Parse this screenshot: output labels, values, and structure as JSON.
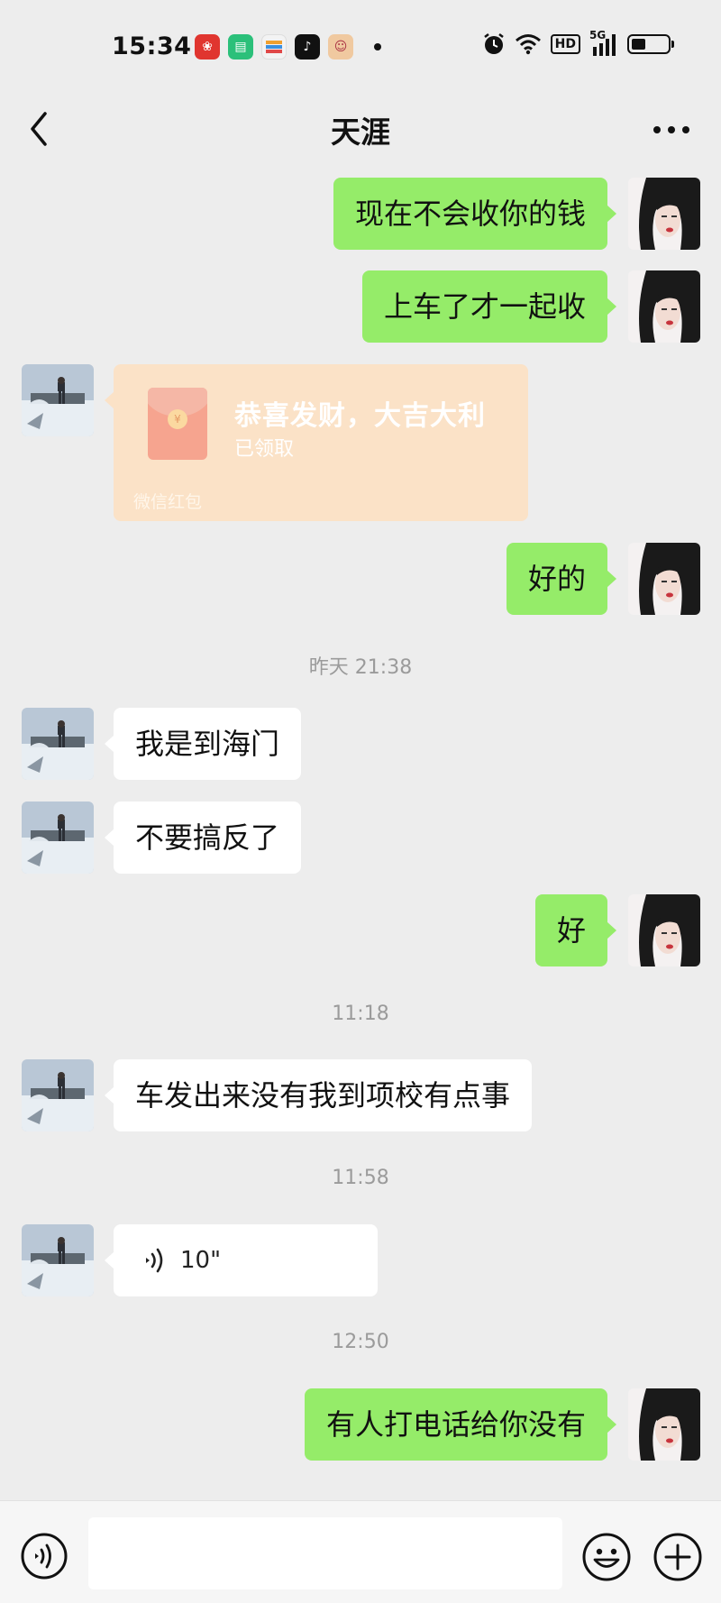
{
  "status_bar": {
    "time": "15:34",
    "app_icons": [
      "pinduoduo-icon",
      "chat-app-icon",
      "wallet-icon",
      "tiktok-icon",
      "game-icon"
    ],
    "network": "5G",
    "hd": "HD",
    "battery_level": 0.4
  },
  "header": {
    "title": "天涯",
    "back_icon": "back-chevron-icon",
    "more_icon": "more-icon"
  },
  "messages": [
    {
      "type": "text",
      "sender": "me",
      "text": "现在不会收你的钱"
    },
    {
      "type": "text",
      "sender": "me",
      "text": "上车了才一起收"
    },
    {
      "type": "red_packet",
      "sender": "them",
      "wish": "恭喜发财，大吉大利",
      "status": "已领取",
      "brand": "微信红包"
    },
    {
      "type": "text",
      "sender": "me",
      "text": "好的"
    },
    {
      "type": "time",
      "text": "昨天 21:38"
    },
    {
      "type": "text",
      "sender": "them",
      "text": "我是到海门"
    },
    {
      "type": "text",
      "sender": "them",
      "text": "不要搞反了"
    },
    {
      "type": "text",
      "sender": "me",
      "text": "好"
    },
    {
      "type": "time",
      "text": "11:18"
    },
    {
      "type": "text",
      "sender": "them",
      "text": "车发出来没有我到项校有点事"
    },
    {
      "type": "time",
      "text": "11:58"
    },
    {
      "type": "voice",
      "sender": "them",
      "duration": "10\""
    },
    {
      "type": "time",
      "text": "12:50"
    },
    {
      "type": "text",
      "sender": "me",
      "text": "有人打电话给你没有"
    }
  ],
  "input_bar": {
    "value": "",
    "voice_icon": "voice-input-icon",
    "emoji_icon": "emoji-icon",
    "plus_icon": "plus-icon"
  },
  "colors": {
    "background": "#ededed",
    "my_bubble": "#95ec69",
    "their_bubble": "#ffffff",
    "red_packet": "#fbe2c7"
  }
}
